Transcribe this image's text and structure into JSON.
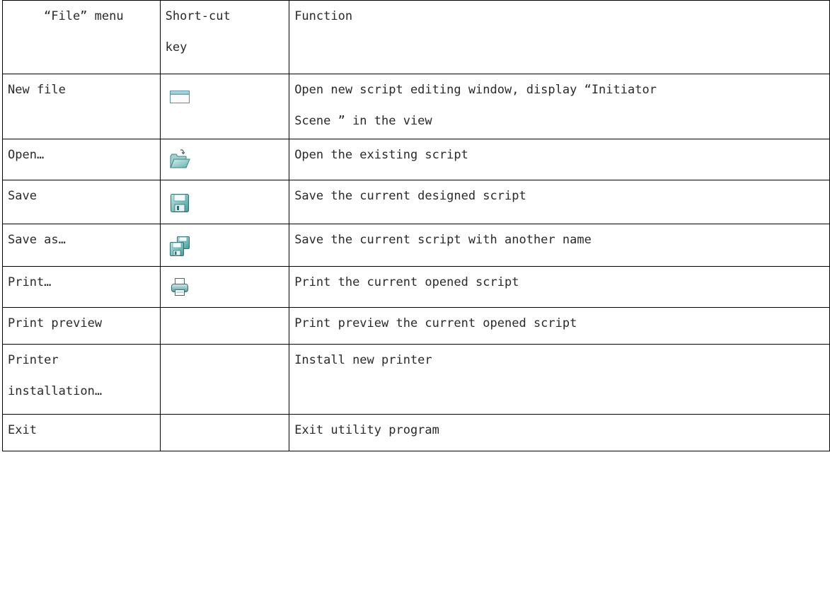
{
  "table": {
    "headers": {
      "menu": "“File” menu",
      "shortcut_line1": "Short-cut",
      "shortcut_line2": "key",
      "function": "Function"
    },
    "rows": [
      {
        "menu": "New file",
        "icon": "new-window-icon",
        "function_line1": "Open new script editing window, display  “Initiator",
        "function_line2": "Scene ” in the view"
      },
      {
        "menu": "Open…",
        "icon": "open-folder-icon",
        "function_line1": "Open the existing script"
      },
      {
        "menu": "Save",
        "icon": "floppy-disk-icon",
        "function_line1": "Save the current designed script"
      },
      {
        "menu": "Save as…",
        "icon": "save-as-icon",
        "function_line1": "Save the current script with another name"
      },
      {
        "menu": "Print…",
        "icon": "printer-icon",
        "function_line1": "Print the current opened script"
      },
      {
        "menu": "Print preview",
        "function_line1": "Print preview the current opened script"
      },
      {
        "menu_line1": "Printer",
        "menu_line2": "installation…",
        "function_line1": "Install new printer"
      },
      {
        "menu": "Exit",
        "function_line1": "Exit utility program"
      }
    ]
  }
}
